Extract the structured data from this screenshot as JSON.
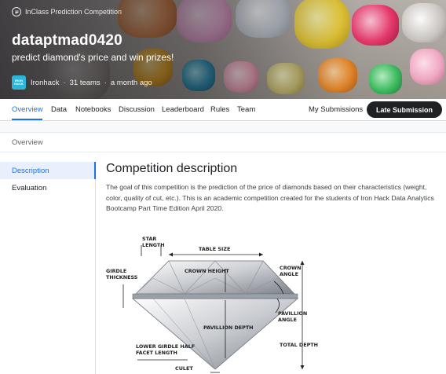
{
  "hero": {
    "badge": "InClass Prediction Competition",
    "title": "dataptmad0420",
    "subtitle": "predict diamond's price and win prizes!",
    "host": "Ironhack",
    "host_logo_text": "IRON HACK",
    "teams": "31 teams",
    "time": "a month ago",
    "separator": "·"
  },
  "tabs": {
    "items": [
      "Overview",
      "Data",
      "Notebooks",
      "Discussion",
      "Leaderboard",
      "Rules",
      "Team"
    ],
    "active": "Overview",
    "my_submissions": "My Submissions",
    "late_submission": "Late Submission"
  },
  "overview_bar": {
    "label": "Overview"
  },
  "sidebar": {
    "items": [
      "Description",
      "Evaluation"
    ],
    "active": "Description"
  },
  "main": {
    "heading": "Competition description",
    "description": "The goal of this competition is the prediction of the price of diamonds based on their characteristics (weight, color, quality of cut, etc.). This is an academic competition created for the students of Iron Hack Data Analytics Bootcamp Part Time Edition April 2020."
  },
  "diagram": {
    "star_length": "STAR LENGTH",
    "table_size": "TABLE SIZE",
    "girdle_thickness": "GIRDLE THICKNESS",
    "crown_height": "CROWN HEIGHT",
    "crown_angle": "CROWN ANGLE",
    "pavillion_angle": "PAVILLION ANGLE",
    "pavillion_depth": "PAVILLION DEPTH",
    "total_depth": "TOTAL DEPTH",
    "lower_girdle": "LOWER GIRDLE HALF FACET LENGTH",
    "culet": "CULET"
  },
  "colors": {
    "accent": "#1a73e8",
    "late_button_bg": "#202124",
    "active_side_bg": "#e8f0fe"
  },
  "icons": {
    "badge": "competition-badge-icon",
    "host": "ironhack-logo"
  }
}
